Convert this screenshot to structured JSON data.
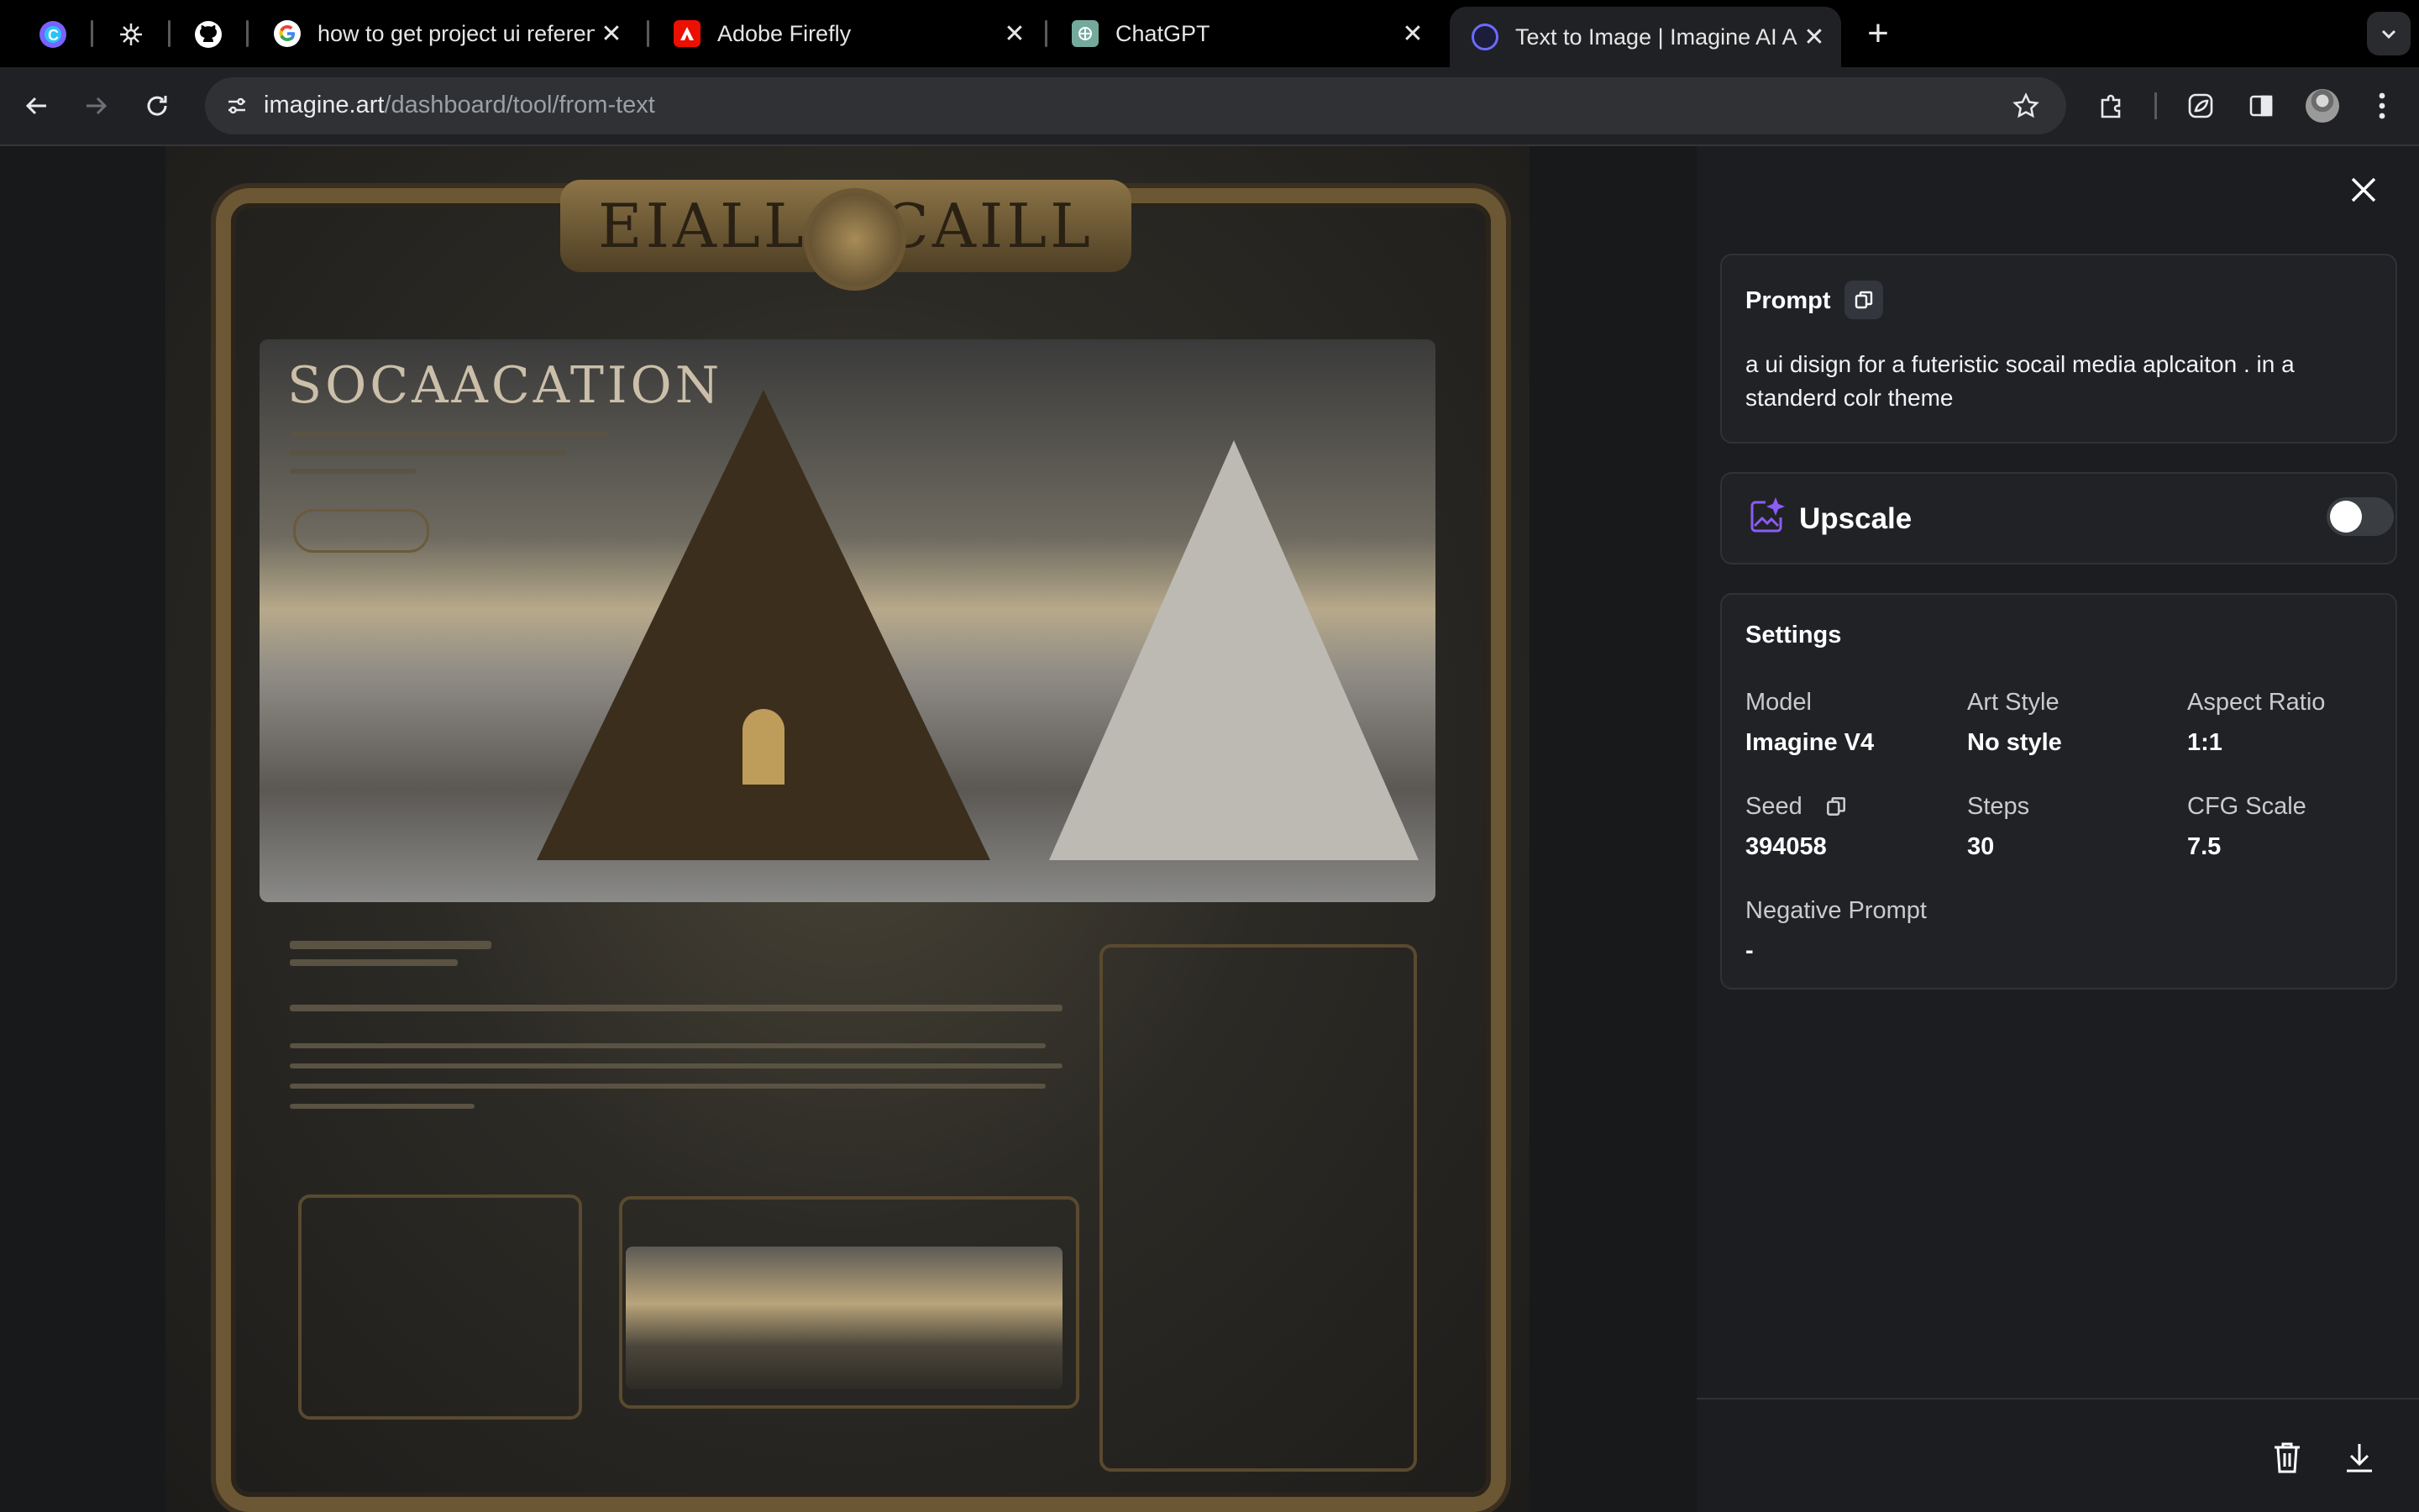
{
  "browser": {
    "tabs": [
      {
        "title": "how to get project ui referenc",
        "favicon": "google-icon"
      },
      {
        "title": "Adobe Firefly",
        "favicon": "adobe-icon"
      },
      {
        "title": "ChatGPT",
        "favicon": "chatgpt-icon"
      },
      {
        "title": "Text to Image | Imagine AI Art",
        "favicon": "imagine-icon",
        "active": true
      }
    ],
    "url_host": "imagine.art",
    "url_path": "/dashboard/tool/from-text"
  },
  "artwork": {
    "heading": "SOCAACATION",
    "banner_left": "EIALL",
    "banner_right": "CAILL"
  },
  "panel": {
    "prompt": {
      "label": "Prompt",
      "text": "a ui disign for a futeristic socail media aplcaiton . in a standerd colr theme"
    },
    "upscale": {
      "label": "Upscale",
      "enabled": false
    },
    "settings": {
      "title": "Settings",
      "model_label": "Model",
      "model_value": "Imagine V4",
      "art_style_label": "Art Style",
      "art_style_value": "No style",
      "aspect_label": "Aspect Ratio",
      "aspect_value": "1:1",
      "seed_label": "Seed",
      "seed_value": "394058",
      "steps_label": "Steps",
      "steps_value": "30",
      "cfg_label": "CFG Scale",
      "cfg_value": "7.5",
      "negative_label": "Negative Prompt",
      "negative_value": "-"
    }
  },
  "colors": {
    "accent": "#8b5cf6",
    "panel_bg": "#1b1d20",
    "card_bg": "#202226"
  }
}
